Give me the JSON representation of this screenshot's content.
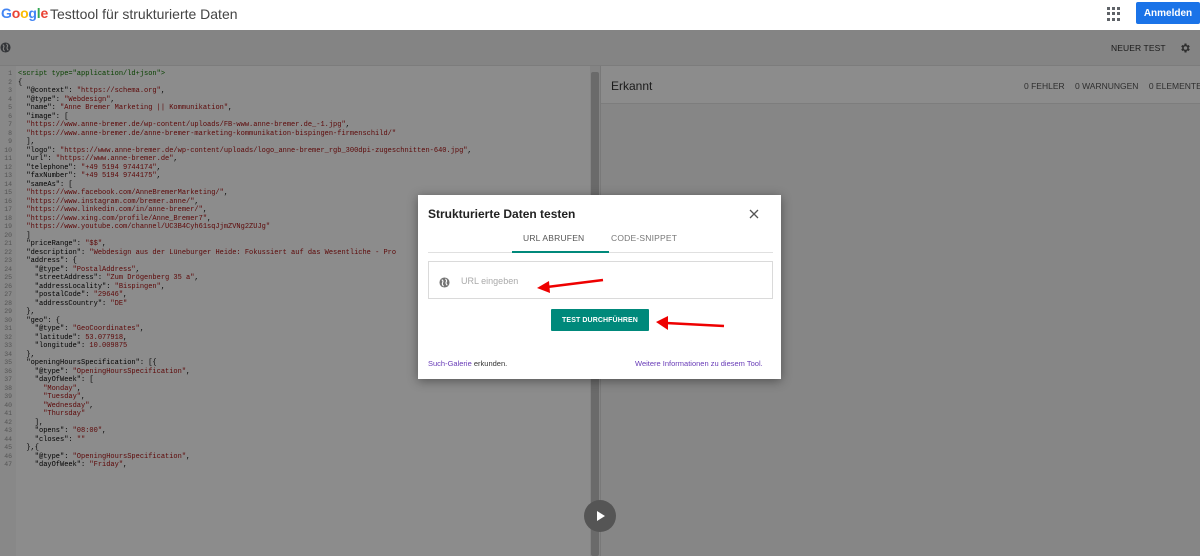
{
  "brand": {
    "logo_letters": [
      "G",
      "o",
      "o",
      "g",
      "l",
      "e"
    ],
    "logo_colors": [
      "#4285F4",
      "#EA4335",
      "#FBBC05",
      "#4285F4",
      "#34A853",
      "#EA4335"
    ]
  },
  "header": {
    "title": "Testtool für strukturierte Daten",
    "signin_label": "Anmelden"
  },
  "toolbar": {
    "new_test_label": "NEUER TEST"
  },
  "results": {
    "detected_label": "Erkannt",
    "errors": "0 FEHLER",
    "warnings": "0 WARNUNGEN",
    "elements": "0 ELEMENTE"
  },
  "dialog": {
    "title": "Strukturierte Daten testen",
    "tabs": [
      {
        "label": "URL ABRUFEN",
        "active": true
      },
      {
        "label": "CODE-SNIPPET",
        "active": false
      }
    ],
    "url_placeholder": "URL eingeben",
    "url_value": "",
    "run_button": "TEST DURCHFÜHREN",
    "footer_link_left": "Such-Galerie",
    "footer_text_left": " erkunden.",
    "footer_link_right": "Weitere Informationen zu diesem Tool."
  },
  "editor": {
    "lines": [
      [
        [
          "tag",
          "<script type=\"application/ld+json\">"
        ]
      ],
      [
        [
          "pl",
          "{"
        ]
      ],
      [
        [
          "pl",
          "  \"@context\": "
        ],
        [
          "str",
          "\"https://schema.org\""
        ],
        [
          "pl",
          ","
        ]
      ],
      [
        [
          "pl",
          "  \"@type\": "
        ],
        [
          "str",
          "\"Webdesign\""
        ],
        [
          "pl",
          ","
        ]
      ],
      [
        [
          "pl",
          "  \"name\": "
        ],
        [
          "str",
          "\"Anne Bremer Marketing || Kommunikation\""
        ],
        [
          "pl",
          ","
        ]
      ],
      [
        [
          "pl",
          "  \"image\": ["
        ]
      ],
      [
        [
          "str",
          "  \"https://www.anne-bremer.de/wp-content/uploads/FB-www.anne-bremer.de_-1.jpg\""
        ],
        [
          "pl",
          ","
        ]
      ],
      [
        [
          "str",
          "  \"https://www.anne-bremer.de/anne-bremer-marketing-kommunikation-bispingen-firmenschild/\""
        ]
      ],
      [
        [
          "pl",
          "  ],"
        ]
      ],
      [
        [
          "pl",
          "  \"logo\": "
        ],
        [
          "str",
          "\"https://www.anne-bremer.de/wp-content/uploads/logo_anne-bremer_rgb_300dpi-zugeschnitten-640.jpg\""
        ],
        [
          "pl",
          ","
        ]
      ],
      [
        [
          "pl",
          "  \"url\": "
        ],
        [
          "str",
          "\"https://www.anne-bremer.de\""
        ],
        [
          "pl",
          ","
        ]
      ],
      [
        [
          "pl",
          "  \"telephone\": "
        ],
        [
          "str",
          "\"+49 5194 9744174\""
        ],
        [
          "pl",
          ","
        ]
      ],
      [
        [
          "pl",
          "  \"faxNumber\": "
        ],
        [
          "str",
          "\"+49 5194 9744175\""
        ],
        [
          "pl",
          ","
        ]
      ],
      [
        [
          "pl",
          "  \"sameAs\": ["
        ]
      ],
      [
        [
          "str",
          "  \"https://www.facebook.com/AnneBremerMarketing/\""
        ],
        [
          "pl",
          ","
        ]
      ],
      [
        [
          "str",
          "  \"https://www.instagram.com/bremer.anne/\""
        ],
        [
          "pl",
          ","
        ]
      ],
      [
        [
          "str",
          "  \"https://www.linkedin.com/in/anne-bremer/\""
        ],
        [
          "pl",
          ","
        ]
      ],
      [
        [
          "str",
          "  \"https://www.xing.com/profile/Anne_Bremer7\""
        ],
        [
          "pl",
          ","
        ]
      ],
      [
        [
          "str",
          "  \"https://www.youtube.com/channel/UC3B4Cyh61sqJjmZVNg2ZUJg\""
        ]
      ],
      [
        [
          "pl",
          "  ]"
        ]
      ],
      [
        [
          "pl",
          "  \"priceRange\": "
        ],
        [
          "str",
          "\"$$\""
        ],
        [
          "pl",
          ","
        ]
      ],
      [
        [
          "pl",
          "  \"description\": "
        ],
        [
          "str",
          "\"Webdesign aus der Lüneburger Heide: Fokussiert auf das Wesentliche - Pro"
        ]
      ],
      [
        [
          "pl",
          "  \"address\": {"
        ]
      ],
      [
        [
          "pl",
          "    \"@type\": "
        ],
        [
          "str",
          "\"PostalAddress\""
        ],
        [
          "pl",
          ","
        ]
      ],
      [
        [
          "pl",
          "    \"streetAddress\": "
        ],
        [
          "str",
          "\"Zum Drögenberg 35 a\""
        ],
        [
          "pl",
          ","
        ]
      ],
      [
        [
          "pl",
          "    \"addressLocality\": "
        ],
        [
          "str",
          "\"Bispingen\""
        ],
        [
          "pl",
          ","
        ]
      ],
      [
        [
          "pl",
          "    \"postalCode\": "
        ],
        [
          "str",
          "\"29646\""
        ],
        [
          "pl",
          ","
        ]
      ],
      [
        [
          "pl",
          "    \"addressCountry\": "
        ],
        [
          "str",
          "\"DE\""
        ]
      ],
      [
        [
          "pl",
          "  },"
        ]
      ],
      [
        [
          "pl",
          "  \"geo\": {"
        ]
      ],
      [
        [
          "pl",
          "    \"@type\": "
        ],
        [
          "str",
          "\"GeoCoordinates\""
        ],
        [
          "pl",
          ","
        ]
      ],
      [
        [
          "pl",
          "    \"latitude\": "
        ],
        [
          "str",
          "53.077918"
        ],
        [
          "pl",
          ","
        ]
      ],
      [
        [
          "pl",
          "    \"longitude\": "
        ],
        [
          "str",
          "10.009875"
        ]
      ],
      [
        [
          "pl",
          "  },"
        ]
      ],
      [
        [
          "pl",
          "  \"openingHoursSpecification\": [{"
        ]
      ],
      [
        [
          "pl",
          "    \"@type\": "
        ],
        [
          "str",
          "\"OpeningHoursSpecification\""
        ],
        [
          "pl",
          ","
        ]
      ],
      [
        [
          "pl",
          "    \"dayOfWeek\": ["
        ]
      ],
      [
        [
          "str",
          "      \"Monday\""
        ],
        [
          "pl",
          ","
        ]
      ],
      [
        [
          "str",
          "      \"Tuesday\""
        ],
        [
          "pl",
          ","
        ]
      ],
      [
        [
          "str",
          "      \"Wednesday\""
        ],
        [
          "pl",
          ","
        ]
      ],
      [
        [
          "str",
          "      \"Thursday\""
        ]
      ],
      [
        [
          "pl",
          "    ],"
        ]
      ],
      [
        [
          "pl",
          "    \"opens\": "
        ],
        [
          "str",
          "\"08:00\""
        ],
        [
          "pl",
          ","
        ]
      ],
      [
        [
          "pl",
          "    \"closes\": "
        ],
        [
          "str",
          "\"\""
        ]
      ],
      [
        [
          "pl",
          "  },{"
        ]
      ],
      [
        [
          "pl",
          "    \"@type\": "
        ],
        [
          "str",
          "\"OpeningHoursSpecification\""
        ],
        [
          "pl",
          ","
        ]
      ],
      [
        [
          "pl",
          "    \"dayOfWeek\": "
        ],
        [
          "str",
          "\"Friday\""
        ],
        [
          "pl",
          ","
        ]
      ]
    ]
  }
}
